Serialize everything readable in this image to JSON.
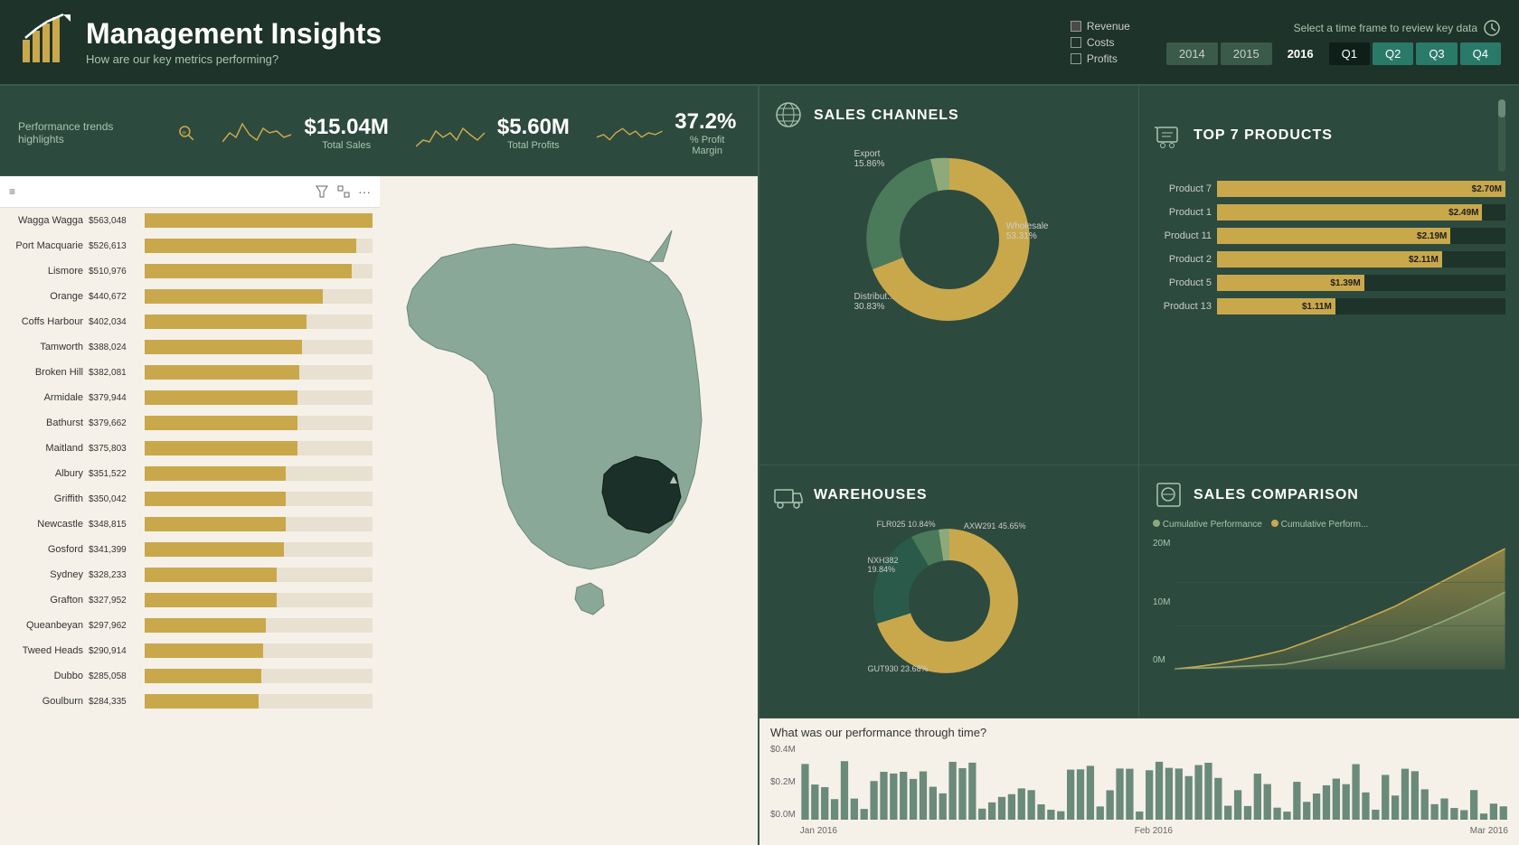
{
  "header": {
    "title": "Management Insights",
    "subtitle": "How are our key metrics performing?",
    "legend": [
      {
        "label": "Revenue",
        "filled": true
      },
      {
        "label": "Costs",
        "filled": false
      },
      {
        "label": "Profits",
        "filled": false
      }
    ],
    "timeframe_label": "Select a time frame to review key data",
    "year_buttons": [
      "2014",
      "2015",
      "2016"
    ],
    "quarter_buttons": [
      "Q1",
      "Q2",
      "Q3",
      "Q4"
    ],
    "active_year": "2016",
    "active_quarter": "Q1"
  },
  "kpi": {
    "highlights_label": "Performance trends highlights",
    "metrics": [
      {
        "value": "$15.04M",
        "label": "Total Sales"
      },
      {
        "value": "$5.60M",
        "label": "Total Profits"
      },
      {
        "value": "37.2%",
        "label": "% Profit Margin"
      }
    ]
  },
  "bar_chart": {
    "cities": [
      {
        "name": "Wagga Wagga",
        "value": "$563,048",
        "pct": 100
      },
      {
        "name": "Port Macquarie",
        "value": "$526,613",
        "pct": 93
      },
      {
        "name": "Lismore",
        "value": "$510,976",
        "pct": 91
      },
      {
        "name": "Orange",
        "value": "$440,672",
        "pct": 78
      },
      {
        "name": "Coffs Harbour",
        "value": "$402,034",
        "pct": 71
      },
      {
        "name": "Tamworth",
        "value": "$388,024",
        "pct": 69
      },
      {
        "name": "Broken Hill",
        "value": "$382,081",
        "pct": 68
      },
      {
        "name": "Armidale",
        "value": "$379,944",
        "pct": 67
      },
      {
        "name": "Bathurst",
        "value": "$379,662",
        "pct": 67
      },
      {
        "name": "Maitland",
        "value": "$375,803",
        "pct": 67
      },
      {
        "name": "Albury",
        "value": "$351,522",
        "pct": 62
      },
      {
        "name": "Griffith",
        "value": "$350,042",
        "pct": 62
      },
      {
        "name": "Newcastle",
        "value": "$348,815",
        "pct": 62
      },
      {
        "name": "Gosford",
        "value": "$341,399",
        "pct": 61
      },
      {
        "name": "Sydney",
        "value": "$328,233",
        "pct": 58
      },
      {
        "name": "Grafton",
        "value": "$327,952",
        "pct": 58
      },
      {
        "name": "Queanbeyan",
        "value": "$297,962",
        "pct": 53
      },
      {
        "name": "Tweed Heads",
        "value": "$290,914",
        "pct": 52
      },
      {
        "name": "Dubbo",
        "value": "$285,058",
        "pct": 51
      },
      {
        "name": "Goulburn",
        "value": "$284,335",
        "pct": 50
      }
    ]
  },
  "sales_channels": {
    "title": "SALES CHANNELS",
    "segments": [
      {
        "label": "Export",
        "pct": "15.86%",
        "color": "#8faa7a"
      },
      {
        "label": "Wholesale",
        "pct": "53.31%",
        "color": "#c9a84c"
      },
      {
        "label": "Distribut...",
        "pct": "30.83%",
        "color": "#4a7a5a"
      }
    ]
  },
  "top_products": {
    "title": "TOP 7 PRODUCTS",
    "products": [
      {
        "name": "Product 7",
        "value": "$2.70M",
        "pct": 100
      },
      {
        "name": "Product 1",
        "value": "$2.49M",
        "pct": 92
      },
      {
        "name": "Product 11",
        "value": "$2.19M",
        "pct": 81
      },
      {
        "name": "Product 2",
        "value": "$2.11M",
        "pct": 78
      },
      {
        "name": "Product 5",
        "value": "$1.39M",
        "pct": 51
      },
      {
        "name": "Product 13",
        "value": "$1.11M",
        "pct": 41
      }
    ]
  },
  "warehouses": {
    "title": "WAREHOUSES",
    "segments": [
      {
        "label": "AXW291",
        "pct": "45.65%",
        "color": "#c9a84c"
      },
      {
        "label": "NXH382",
        "pct": "19.84%",
        "color": "#4a7a5a"
      },
      {
        "label": "FLR025",
        "pct": "10.84%",
        "color": "#8faa7a"
      },
      {
        "label": "GUT930",
        "pct": "23.68%",
        "color": "#2a5a4a"
      }
    ]
  },
  "sales_comparison": {
    "title": "SALES COMPARISON",
    "legend": [
      {
        "label": "Cumulative Performance",
        "color": "#8faa7a"
      },
      {
        "label": "Cumulative Perform...",
        "color": "#c9a84c"
      }
    ],
    "y_labels": [
      "20M",
      "10M",
      "0M"
    ]
  },
  "perf_time": {
    "title": "What was our performance through time?",
    "y_labels": [
      "$0.4M",
      "$0.2M",
      "$0.0M"
    ],
    "x_labels": [
      "Jan 2016",
      "Feb 2016",
      "Mar 2016"
    ]
  }
}
